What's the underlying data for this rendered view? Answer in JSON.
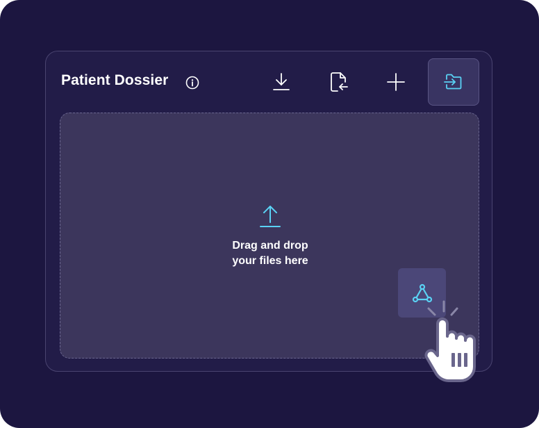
{
  "header": {
    "title": "Patient Dossier"
  },
  "toolbar": {
    "items": [
      {
        "name": "download-icon",
        "active": false
      },
      {
        "name": "file-import-icon",
        "active": false
      },
      {
        "name": "plus-icon",
        "active": false
      },
      {
        "name": "folder-enter-icon",
        "active": true
      }
    ]
  },
  "dropzone": {
    "line1": "Drag and drop",
    "line2": "your files here"
  },
  "dragged_file": {
    "icon": "acrobat-pdf-icon"
  },
  "cursor": {
    "icon": "hand-pointer-click-icon"
  },
  "colors": {
    "background": "#1c1640",
    "panel": "#221c48",
    "dropzone": "#3c365c",
    "accent": "#5ad2f4",
    "text": "#ffffff"
  }
}
